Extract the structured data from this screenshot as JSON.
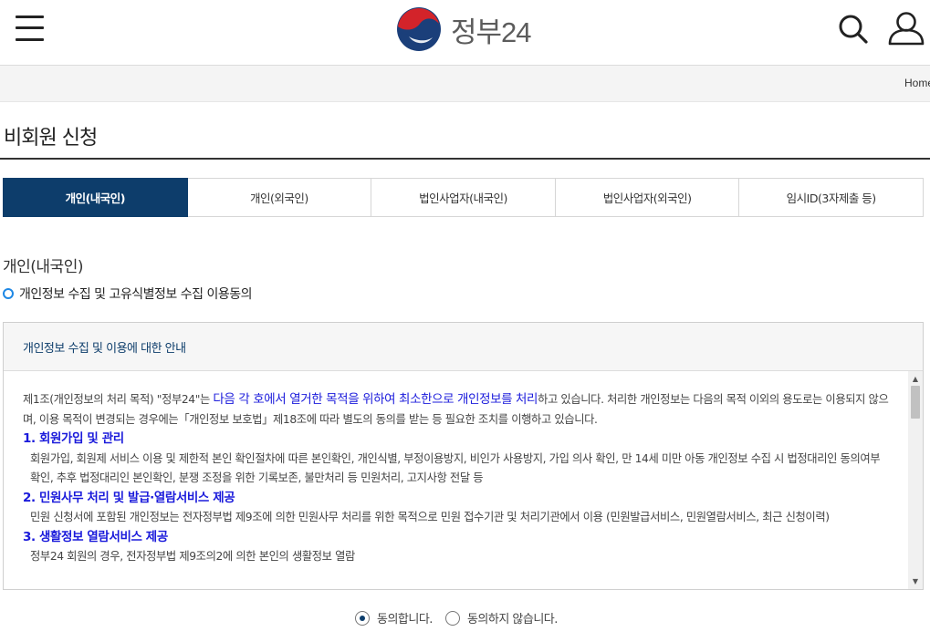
{
  "header": {
    "logo_text": "정부24",
    "menu_icon": "hamburger-menu-icon",
    "search_icon": "search-icon",
    "user_icon": "user-icon"
  },
  "breadcrumb": {
    "home": "Home"
  },
  "page_title": "비회원 신청",
  "tabs": [
    {
      "label": "개인(내국인)",
      "active": true
    },
    {
      "label": "개인(외국인)",
      "active": false
    },
    {
      "label": "법인사업자(내국인)",
      "active": false
    },
    {
      "label": "법인사업자(외국인)",
      "active": false
    },
    {
      "label": "임시ID(3자제출 등)",
      "active": false
    }
  ],
  "section_title": "개인(내국인)",
  "sub_title": "개인정보 수집 및 고유식별정보 수집 이용동의",
  "notice": {
    "header": "개인정보 수집 및 이용에 대한 안내",
    "intro_a": "제1조(개인정보의 처리 목적) \"정부24\"는 ",
    "intro_highlight": "다음 각 호에서 열거한 목적을 위하여 최소한으로 개인정보를 처리",
    "intro_b": "하고 있습니다. 처리한 개인정보는 다음의 목적 이외의 용도로는 이용되지 않으며, 이용 목적이 변경되는 경우에는「개인정보 보호법」제18조에 따라 별도의 동의를 받는 등 필요한 조치를 이행하고 있습니다.",
    "items": [
      {
        "title": "1. 회원가입 및 관리",
        "text": "회원가입, 회원제 서비스 이용 및 제한적 본인 확인절차에 따른 본인확인, 개인식별, 부정이용방지, 비인가 사용방지, 가입 의사 확인, 만 14세 미만 아동 개인정보 수집 시 법정대리인 동의여부 확인, 추후 법정대리인 본인확인, 분쟁 조정을 위한 기록보존, 불만처리 등 민원처리, 고지사항 전달 등"
      },
      {
        "title": "2. 민원사무 처리 및 발급·열람서비스 제공",
        "text": "민원 신청서에 포함된 개인정보는 전자정부법 제9조에 의한 민원사무 처리를 위한 목적으로 민원 접수기관 및 처리기관에서 이용 (민원발급서비스, 민원열람서비스, 최근 신청이력)"
      },
      {
        "title": "3. 생활정보 열람서비스 제공",
        "text": "정부24 회원의 경우, 전자정부법 제9조의2에 의한 본인의 생활정보 열람"
      }
    ]
  },
  "consent": {
    "agree": "동의합니다.",
    "disagree": "동의하지 않습니다.",
    "selected": "agree"
  }
}
